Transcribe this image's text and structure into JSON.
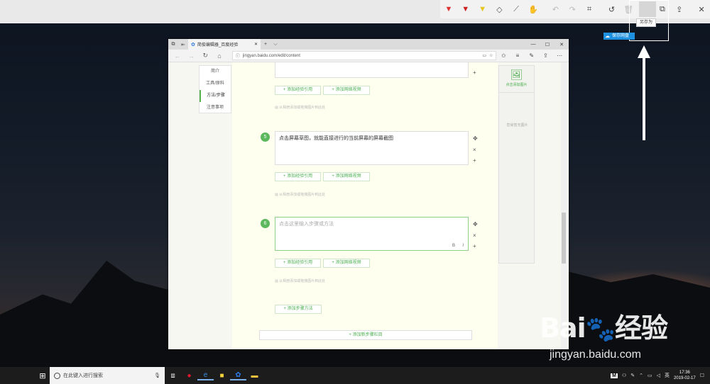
{
  "sketch_toolbar": {
    "tools": [
      {
        "name": "ballpoint-pen-icon",
        "glyph": "▼",
        "color": "#e03030"
      },
      {
        "name": "pencil-icon",
        "glyph": "▼",
        "color": "#cc2222"
      },
      {
        "name": "highlighter-icon",
        "glyph": "▼",
        "color": "#e6c619"
      },
      {
        "name": "eraser-icon",
        "glyph": "◇",
        "color": "#555555"
      },
      {
        "name": "ruler-icon",
        "glyph": "⟋",
        "color": "#555555"
      },
      {
        "name": "touch-writing-icon",
        "glyph": "✋",
        "color": "#555555"
      },
      {
        "name": "undo-icon",
        "glyph": "↶",
        "color": "#bbbbbb"
      },
      {
        "name": "redo-icon",
        "glyph": "↷",
        "color": "#bbbbbb"
      },
      {
        "name": "crop-icon",
        "glyph": "⌗",
        "color": "#444444"
      },
      {
        "name": "history-icon",
        "glyph": "↺",
        "color": "#444444"
      },
      {
        "name": "delete-icon",
        "glyph": "🗑",
        "color": "#bbbbbb"
      },
      {
        "name": "save-icon",
        "glyph": "▣",
        "color": "#444444"
      },
      {
        "name": "copy-icon",
        "glyph": "⧉",
        "color": "#444444"
      },
      {
        "name": "share-icon",
        "glyph": "⇪",
        "color": "#444444"
      },
      {
        "name": "close-icon",
        "glyph": "✕",
        "color": "#444444"
      }
    ],
    "saveas_tooltip": "另存为"
  },
  "cloud_button": {
    "label": "保存网盘"
  },
  "browser": {
    "tab_title": "简俊编辑器_百度经验",
    "new_tab": "+",
    "tab_menu": "⌵",
    "win_min": "—",
    "win_max": "☐",
    "win_close": "✕",
    "url": "jingyan.baidu.com/edit/content"
  },
  "left_nav": [
    "简介",
    "工具/原料",
    "方法/步骤",
    "注意事项"
  ],
  "editor": {
    "add_ref": "+ 添加经验引用",
    "add_video": "+ 添加网络视频",
    "upload_hint": "从相册添加或拖拽图片到此处",
    "step5_num": "5",
    "step5_text": "点击屏幕草图，就能直接进行的当前屏幕的屏幕截图",
    "step6_num": "6",
    "step6_placeholder": "点击这里输入步骤或方法",
    "fmt_bold": "B",
    "fmt_italic": "I",
    "add_step_method": "+ 添加步骤方法",
    "add_new_section": "+ 添加新步骤栏目"
  },
  "right_panel": {
    "upload_label": "点击添加图片",
    "empty_label": "您尚暂无图片"
  },
  "watermark": {
    "logo_text": "Bai",
    "logo_suffix": "经验",
    "url": "jingyan.baidu.com"
  },
  "taskbar": {
    "search_placeholder": "在此键入进行搜索",
    "time": "17:36",
    "date": "2019-02-17",
    "ime": "英",
    "tray_m": "M"
  }
}
